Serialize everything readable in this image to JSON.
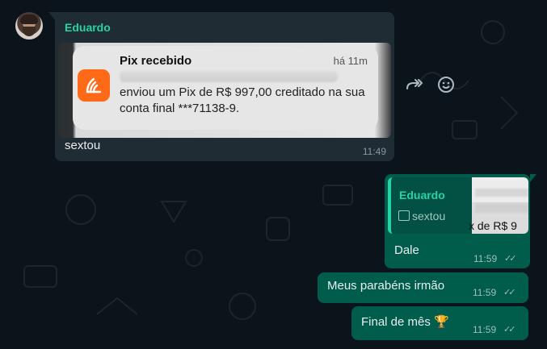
{
  "incoming": {
    "sender": "Eduardo",
    "notification": {
      "title": "Pix recebido",
      "time": "há 11m",
      "body": "enviou um Pix de R$ 997,00 creditado na sua conta final ***71138-9."
    },
    "caption": "sextou",
    "time": "11:49"
  },
  "outgoing": [
    {
      "quote_sender": "Eduardo",
      "quote_text": "sextou",
      "quote_thumb_text": "x de R$ 9",
      "text": "Dale",
      "time": "11:59"
    },
    {
      "text": "Meus parabéns irmão",
      "time": "11:59"
    },
    {
      "text": "Final de mês 🏆",
      "time": "11:59"
    }
  ],
  "colors": {
    "background": "#0b141a",
    "incoming_bubble": "#202c33",
    "outgoing_bubble": "#005c4b",
    "accent": "#25d3a5",
    "pix_icon": "#ff6a18"
  },
  "icons": [
    "forward-icon",
    "emoji-icon",
    "image-icon",
    "double-check-icon"
  ]
}
